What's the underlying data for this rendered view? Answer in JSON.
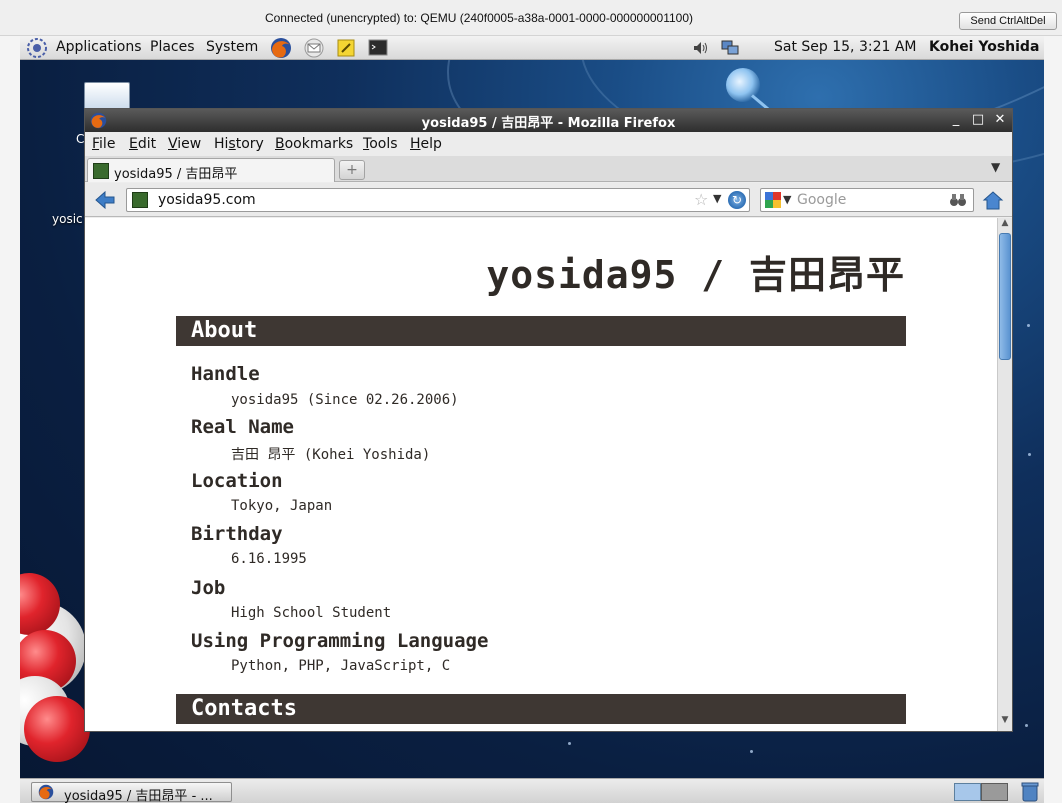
{
  "vnc": {
    "status": "Connected (unencrypted) to: QEMU (240f0005-a38a-0001-0000-000000001100)",
    "send_button": "Send CtrlAltDel"
  },
  "top_panel": {
    "menus": [
      "Applications",
      "Places",
      "System"
    ],
    "clock": "Sat Sep 15,  3:21 AM",
    "user": "Kohei Yoshida"
  },
  "desktop": {
    "icon_label_partial": "C",
    "icon_label_partial_2": "yosic"
  },
  "firefox": {
    "title": "yosida95 / 吉田昂平 - Mozilla Firefox",
    "menus": [
      "File",
      "Edit",
      "View",
      "History",
      "Bookmarks",
      "Tools",
      "Help"
    ],
    "menu_mnemonics": [
      "F",
      "E",
      "V",
      "s",
      "B",
      "T",
      "H"
    ],
    "tab_label": "yosida95 / 吉田昂平",
    "url": "yosida95.com",
    "search_placeholder": "Google"
  },
  "page": {
    "title": "yosida95 / 吉田昂平",
    "sections": [
      {
        "heading": "About",
        "items": [
          {
            "label": "Handle",
            "value": "yosida95 (Since 02.26.2006)"
          },
          {
            "label": "Real Name",
            "value": "吉田 昂平 (Kohei Yoshida)"
          },
          {
            "label": "Location",
            "value": "Tokyo, Japan"
          },
          {
            "label": "Birthday",
            "value": "6.16.1995"
          },
          {
            "label": "Job",
            "value": "High School Student"
          },
          {
            "label": "Using Programming Language",
            "value": "Python, PHP, JavaScript, C"
          }
        ]
      },
      {
        "heading": "Contacts",
        "items": []
      }
    ]
  },
  "taskbar": {
    "window_label": "yosida95 / 吉田昂平 - ..."
  },
  "colors": {
    "section_bar": "#3e3733",
    "text": "#2f2a26",
    "titlebar": "#3a3a3a"
  }
}
